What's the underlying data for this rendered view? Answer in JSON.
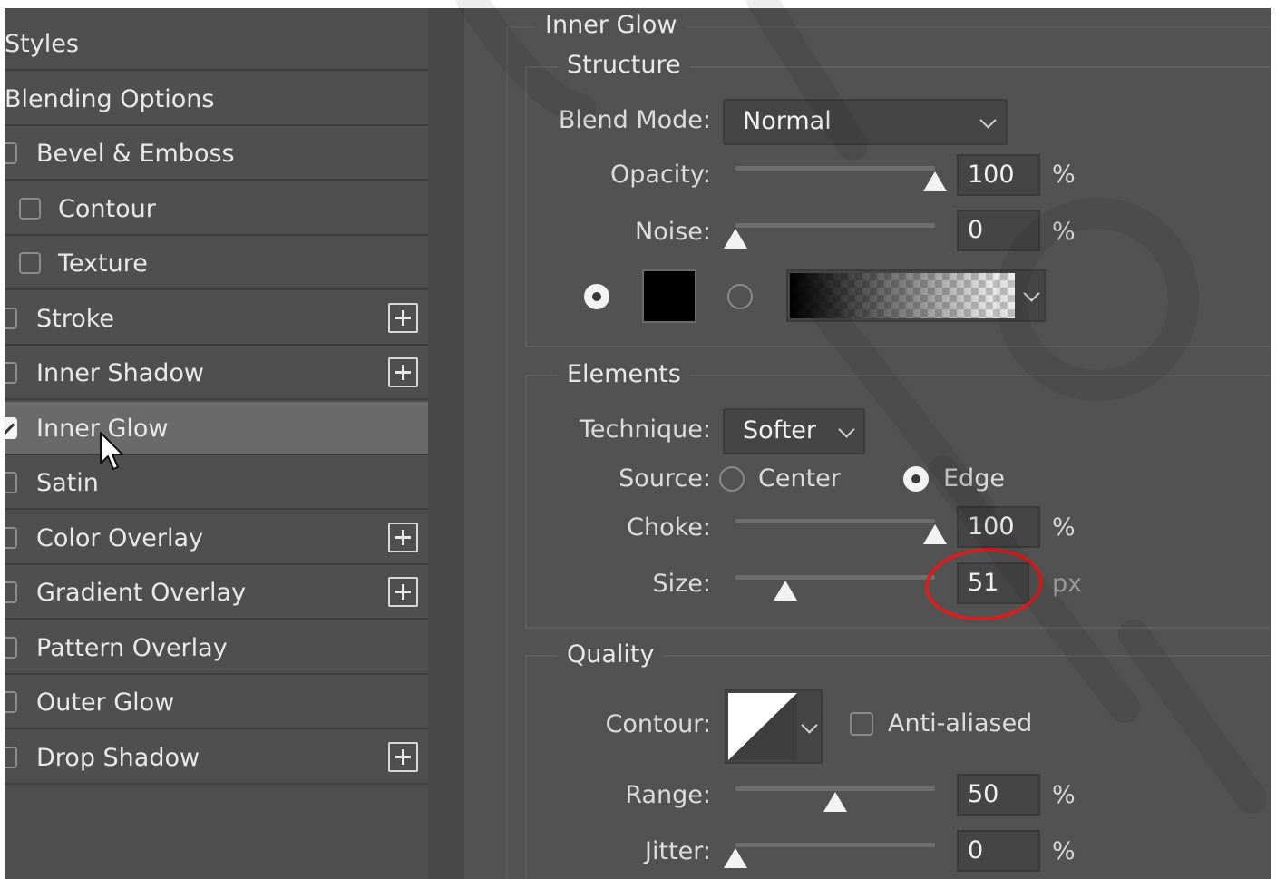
{
  "styles_panel": {
    "header": "Styles",
    "blending_options": "Blending Options",
    "items": [
      {
        "label": "Bevel & Emboss",
        "checked": false,
        "has_add": false,
        "indent": false
      },
      {
        "label": "Contour",
        "checked": false,
        "has_add": false,
        "indent": true
      },
      {
        "label": "Texture",
        "checked": false,
        "has_add": false,
        "indent": true
      },
      {
        "label": "Stroke",
        "checked": false,
        "has_add": true,
        "indent": false
      },
      {
        "label": "Inner Shadow",
        "checked": false,
        "has_add": true,
        "indent": false
      },
      {
        "label": "Inner Glow",
        "checked": true,
        "has_add": false,
        "indent": false,
        "selected": true
      },
      {
        "label": "Satin",
        "checked": false,
        "has_add": false,
        "indent": false
      },
      {
        "label": "Color Overlay",
        "checked": false,
        "has_add": true,
        "indent": false
      },
      {
        "label": "Gradient Overlay",
        "checked": false,
        "has_add": true,
        "indent": false
      },
      {
        "label": "Pattern Overlay",
        "checked": false,
        "has_add": false,
        "indent": false
      },
      {
        "label": "Outer Glow",
        "checked": false,
        "has_add": false,
        "indent": false
      },
      {
        "label": "Drop Shadow",
        "checked": false,
        "has_add": true,
        "indent": false
      }
    ]
  },
  "panel_title": "Inner Glow",
  "structure": {
    "title": "Structure",
    "blend_mode_label": "Blend Mode:",
    "blend_mode_value": "Normal",
    "opacity_label": "Opacity:",
    "opacity_value": "100",
    "opacity_unit": "%",
    "opacity_level": 1.0,
    "noise_label": "Noise:",
    "noise_value": "0",
    "noise_unit": "%",
    "noise_level": 0.0,
    "color_swatch": "#000000",
    "color_mode": "solid"
  },
  "elements": {
    "title": "Elements",
    "technique_label": "Technique:",
    "technique_value": "Softer",
    "source_label": "Source:",
    "source_center": "Center",
    "source_edge": "Edge",
    "source_selected": "Edge",
    "choke_label": "Choke:",
    "choke_value": "100",
    "choke_unit": "%",
    "choke_level": 1.0,
    "size_label": "Size:",
    "size_value": "51",
    "size_unit": "px",
    "size_level": 0.25
  },
  "quality": {
    "title": "Quality",
    "contour_label": "Contour:",
    "anti_aliased_label": "Anti-aliased",
    "anti_aliased": false,
    "range_label": "Range:",
    "range_value": "50",
    "range_unit": "%",
    "range_level": 0.5,
    "jitter_label": "Jitter:",
    "jitter_value": "0",
    "jitter_unit": "%",
    "jitter_level": 0.0
  },
  "colors": {
    "panel_bg": "#525252",
    "selected_row": "#6a6a6a",
    "annotation": "#d42020"
  }
}
